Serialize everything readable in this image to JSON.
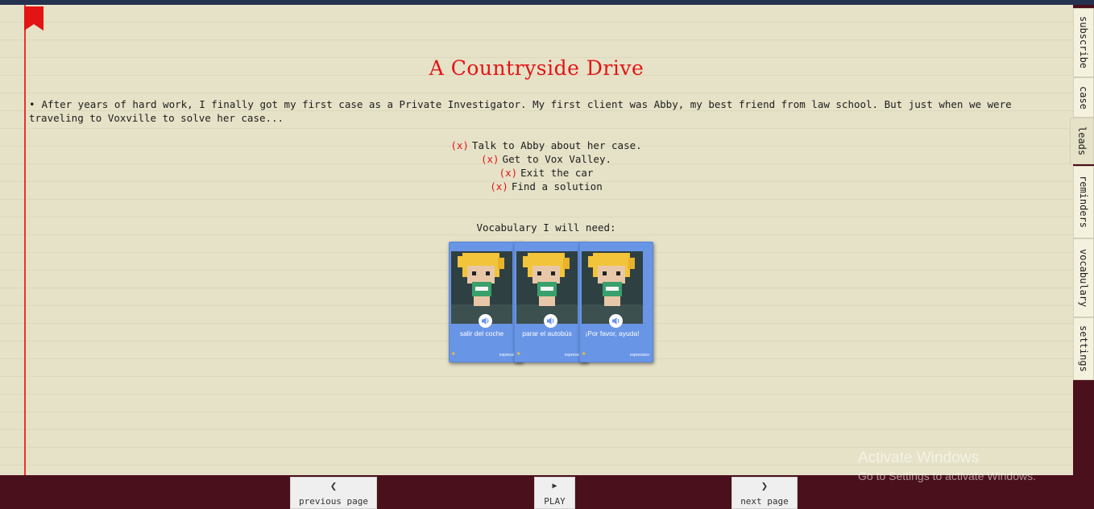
{
  "page": {
    "title": "A Countryside Drive",
    "intro": "After years of hard work, I finally got my first case as a Private Investigator. My first client was Abby, my best friend from law school. But just when we were traveling to Voxville to solve her case...",
    "bullet": "•"
  },
  "objectives": {
    "mark": "(x)",
    "items": [
      {
        "text": "Talk to Abby about her case."
      },
      {
        "text": "Get to Vox Valley."
      },
      {
        "text": "Exit the car"
      },
      {
        "text": "Find a solution"
      }
    ]
  },
  "vocab": {
    "heading": "Vocabulary I will need:",
    "cards": [
      {
        "label": "salir del coche",
        "type": "expression",
        "icon": "speaker-icon"
      },
      {
        "label": "parar el autobús",
        "type": "expression",
        "icon": "speaker-icon"
      },
      {
        "label": "¡Por favor, ayuda!",
        "type": "expression",
        "icon": "speaker-icon"
      }
    ]
  },
  "tabs": [
    {
      "label": "subscribe"
    },
    {
      "label": "case"
    },
    {
      "label": "leads"
    },
    {
      "label": "reminders"
    },
    {
      "label": "vocabulary"
    },
    {
      "label": "settings"
    }
  ],
  "nav": {
    "previous": {
      "label": "previous page",
      "icon": "chevron-left-icon"
    },
    "play": {
      "label": "PLAY",
      "icon": "play-icon"
    },
    "next": {
      "label": "next page",
      "icon": "chevron-right-icon"
    }
  },
  "watermark": {
    "line1": "Activate Windows",
    "line2": "Go to Settings to activate Windows."
  },
  "colors": {
    "paper": "#e6e2c8",
    "accent_red": "#e31414",
    "card_blue": "#6995e6",
    "frame": "#4a101c"
  }
}
